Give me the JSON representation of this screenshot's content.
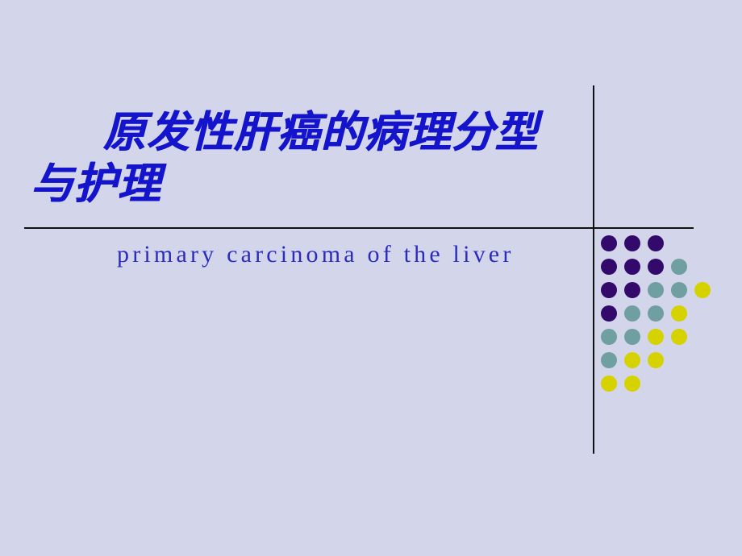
{
  "slide": {
    "background_color": "#d3d6ea",
    "title": {
      "lines": [
        "原发性肝癌的病理分型",
        "与护理"
      ],
      "color": "#1414cc"
    },
    "subtitle": {
      "text": "primary carcinoma of the liver",
      "color": "#2b2bc0"
    },
    "rules": {
      "color": "#111111",
      "horizontal_label": "horizontal-divider",
      "vertical_label": "vertical-divider"
    },
    "decoration": {
      "name": "dot-grid",
      "palette": {
        "purple": "#330a6b",
        "teal": "#6f9fa0",
        "yellow": "#d6d200"
      },
      "cell": 29,
      "size": 20,
      "rows": [
        [
          "purple",
          "purple",
          "purple"
        ],
        [
          "purple",
          "purple",
          "purple",
          "teal"
        ],
        [
          "purple",
          "purple",
          "teal",
          "teal",
          "yellow"
        ],
        [
          "purple",
          "teal",
          "teal",
          "yellow"
        ],
        [
          "teal",
          "teal",
          "yellow",
          "yellow"
        ],
        [
          "teal",
          "yellow",
          "yellow"
        ],
        [
          "yellow",
          "yellow"
        ]
      ]
    }
  }
}
